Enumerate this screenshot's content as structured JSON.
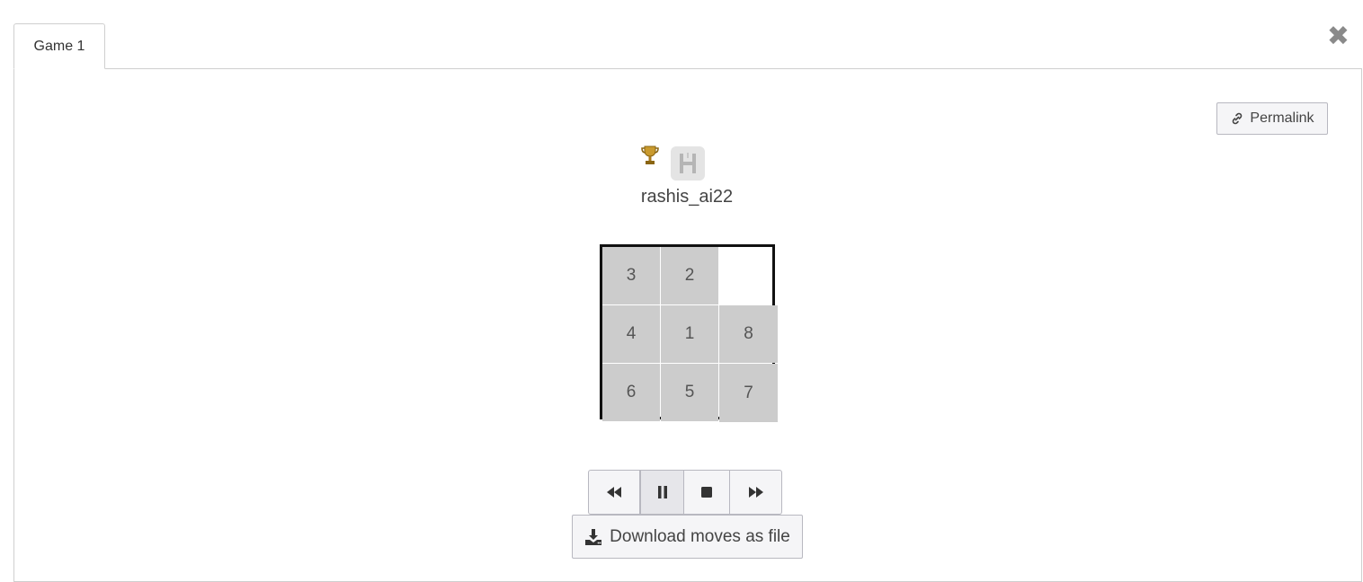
{
  "tabs": [
    {
      "label": "Game 1"
    }
  ],
  "close_icon": "close-x-icon",
  "permalink": {
    "label": "Permalink",
    "icon": "link-icon"
  },
  "player": {
    "name": "rashis_ai22",
    "trophy_icon": "trophy-icon",
    "avatar_icon": "avatar-h-icon"
  },
  "board": {
    "rows": [
      [
        "3",
        "2",
        ""
      ],
      [
        "4",
        "1",
        "8"
      ],
      [
        "6",
        "5",
        "7"
      ]
    ]
  },
  "controls": [
    {
      "name": "rewind-button",
      "icon": "rewind-icon"
    },
    {
      "name": "pause-button",
      "icon": "pause-icon"
    },
    {
      "name": "stop-button",
      "icon": "stop-icon"
    },
    {
      "name": "fast-forward-button",
      "icon": "fast-forward-icon"
    }
  ],
  "download": {
    "label": "Download moves as file",
    "icon": "download-icon"
  },
  "colors": {
    "tile": "#cccccc",
    "border": "#111111"
  }
}
